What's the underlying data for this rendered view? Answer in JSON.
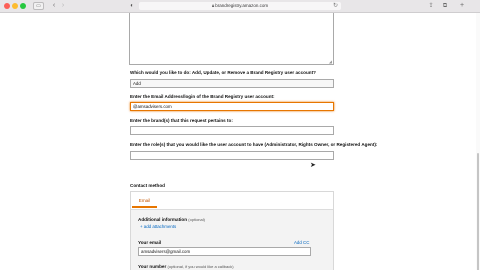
{
  "browser": {
    "url": "brandregistry.amazon.com",
    "icons": [
      "sidebar-icon",
      "back-icon",
      "forward-icon",
      "shield-icon",
      "lock-icon",
      "reload-icon",
      "share-icon",
      "tabs-icon",
      "new-tab-icon"
    ]
  },
  "form": {
    "q_action": "Which would you like to do: Add, Update, or Remove a Brand Registry user account?",
    "action_value": "Add",
    "q_email": "Enter the Email Address/login of the Brand Registry user account:",
    "email_value": "@amsadvisers.com",
    "q_brand": "Enter the brand(s) that this request pertains to:",
    "brand_value": "",
    "q_role": "Enter the role(s) that you would like the user account to have (Administrator, Rights Owner, or Registered Agent):",
    "role_value": ""
  },
  "contact": {
    "heading": "Contact method",
    "tab_email": "Email",
    "additional_label": "Additional information",
    "additional_optional": "(optional)",
    "add_attachments": "+ add attachments",
    "your_email_label": "Your email",
    "add_cc": "Add CC",
    "your_email_value": "amsadvisers@gmail.com",
    "your_number_label": "Your number",
    "your_number_optional": "(optional, if you would like a callback)"
  },
  "colors": {
    "focus_orange": "#e77600",
    "link_blue": "#0066c0"
  }
}
